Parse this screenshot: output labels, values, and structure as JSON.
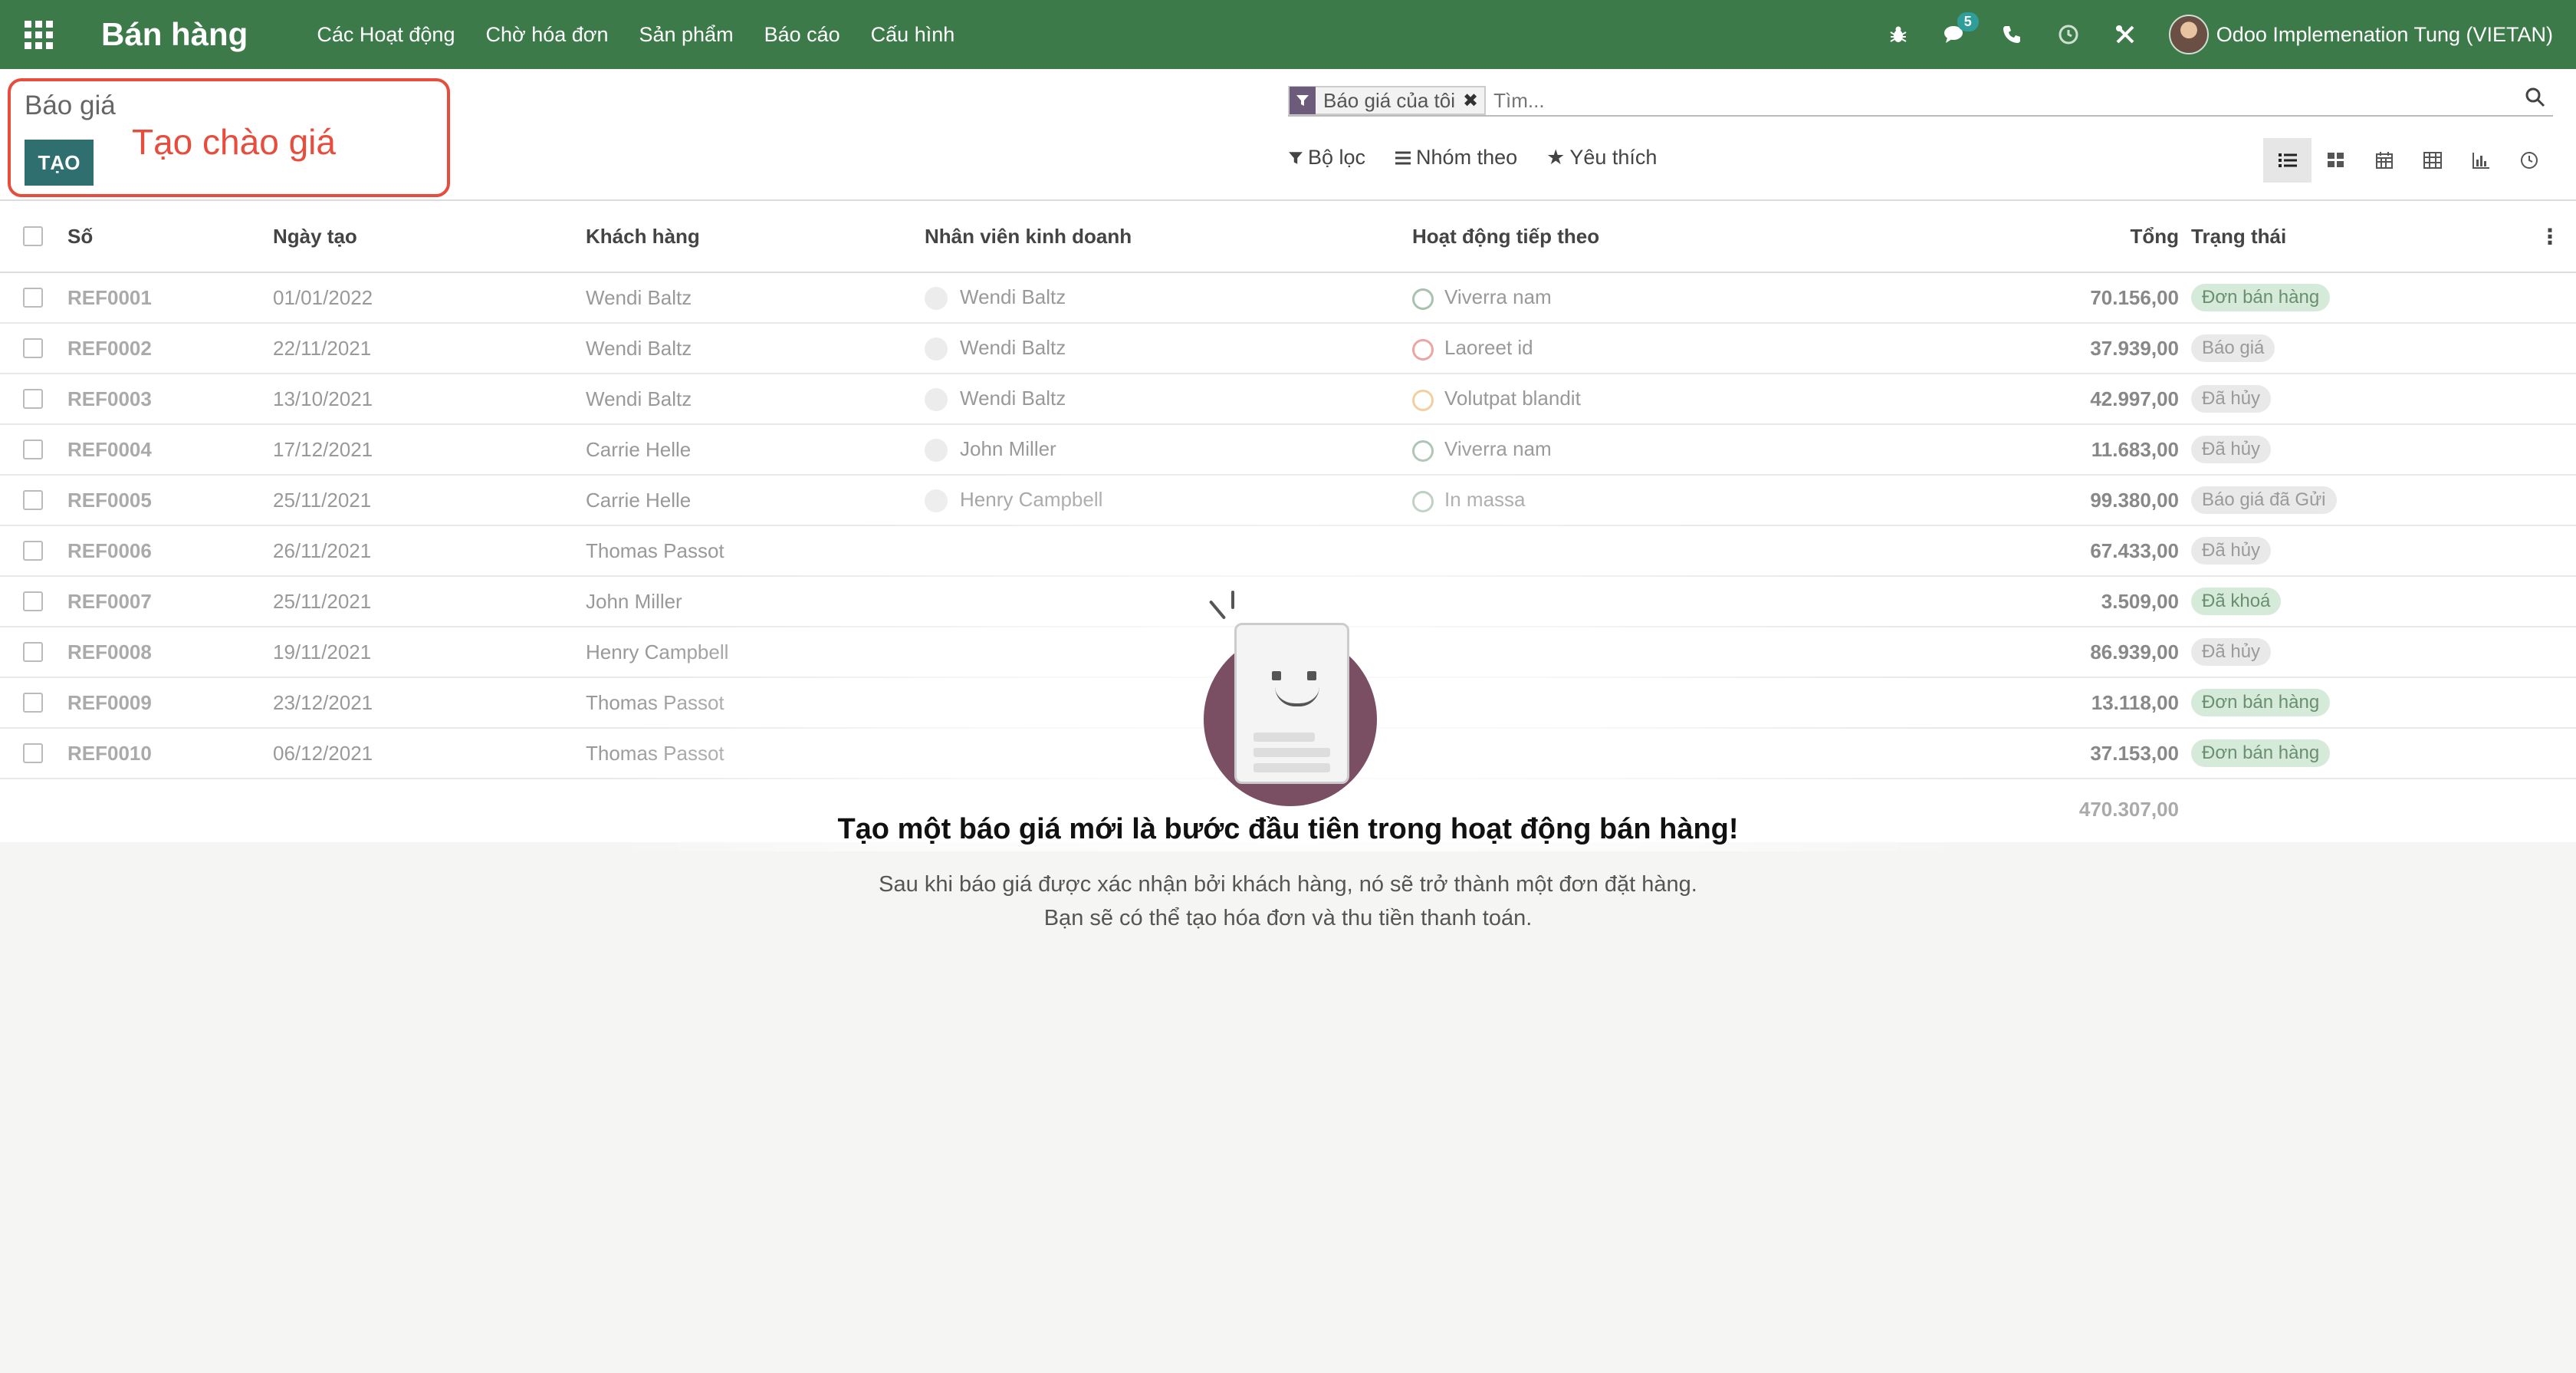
{
  "navbar": {
    "app_title": "Bán hàng",
    "menu": [
      "Các Hoạt động",
      "Chờ hóa đơn",
      "Sản phẩm",
      "Báo cáo",
      "Cấu hình"
    ],
    "messages_count": "5",
    "user_name": "Odoo Implemenation Tung (VIETAN)"
  },
  "control": {
    "breadcrumb": "Báo giá",
    "create_label": "TẠO",
    "annotation": "Tạo chào giá",
    "facet_label": "Báo giá của tôi",
    "search_placeholder": "Tìm...",
    "filters_label": "Bộ lọc",
    "groupby_label": "Nhóm theo",
    "favorites_label": "Yêu thích"
  },
  "table": {
    "headers": {
      "number": "Số",
      "date": "Ngày tạo",
      "customer": "Khách hàng",
      "salesperson": "Nhân viên kinh doanh",
      "activity": "Hoạt động tiếp theo",
      "total": "Tổng",
      "status": "Trạng thái"
    },
    "rows": [
      {
        "number": "REF0001",
        "date": "01/01/2022",
        "customer": "Wendi Baltz",
        "salesperson": "Wendi Baltz",
        "activity": "Viverra nam",
        "total": "70.156,00",
        "status": "Đơn bán hàng"
      },
      {
        "number": "REF0002",
        "date": "22/11/2021",
        "customer": "Wendi Baltz",
        "salesperson": "Wendi Baltz",
        "activity": "Laoreet id",
        "total": "37.939,00",
        "status": "Báo giá"
      },
      {
        "number": "REF0003",
        "date": "13/10/2021",
        "customer": "Wendi Baltz",
        "salesperson": "Wendi Baltz",
        "activity": "Volutpat blandit",
        "total": "42.997,00",
        "status": "Đã hủy"
      },
      {
        "number": "REF0004",
        "date": "17/12/2021",
        "customer": "Carrie Helle",
        "salesperson": "John Miller",
        "activity": "Viverra nam",
        "total": "11.683,00",
        "status": "Đã hủy"
      },
      {
        "number": "REF0005",
        "date": "25/11/2021",
        "customer": "Carrie Helle",
        "salesperson": "Henry Campbell",
        "activity": "In massa",
        "total": "99.380,00",
        "status": "Báo giá đã Gửi"
      },
      {
        "number": "REF0006",
        "date": "26/11/2021",
        "customer": "Thomas Passot",
        "salesperson": "",
        "activity": "",
        "total": "67.433,00",
        "status": "Đã hủy"
      },
      {
        "number": "REF0007",
        "date": "25/11/2021",
        "customer": "John Miller",
        "salesperson": "",
        "activity": "",
        "total": "3.509,00",
        "status": "Đã khoá"
      },
      {
        "number": "REF0008",
        "date": "19/11/2021",
        "customer": "Henry Campbell",
        "salesperson": "",
        "activity": "",
        "total": "86.939,00",
        "status": "Đã hủy"
      },
      {
        "number": "REF0009",
        "date": "23/12/2021",
        "customer": "Thomas Passot",
        "salesperson": "",
        "activity": "",
        "total": "13.118,00",
        "status": "Đơn bán hàng"
      },
      {
        "number": "REF0010",
        "date": "06/12/2021",
        "customer": "Thomas Passot",
        "salesperson": "",
        "activity": "",
        "total": "37.153,00",
        "status": "Đơn bán hàng"
      }
    ],
    "grand_total": "470.307,00"
  },
  "helper": {
    "title": "Tạo một báo giá mới là bước đầu tiên trong hoạt động bán hàng!",
    "line1": "Sau khi báo giá được xác nhận bởi khách hàng, nó sẽ trở thành một đơn đặt hàng.",
    "line2": "Bạn sẽ có thể tạo hóa đơn và thu tiền thanh toán."
  },
  "colors": {
    "navbar": "#3d7a4a",
    "primary_button": "#2f6f6f",
    "annotation": "#e74c3c"
  }
}
